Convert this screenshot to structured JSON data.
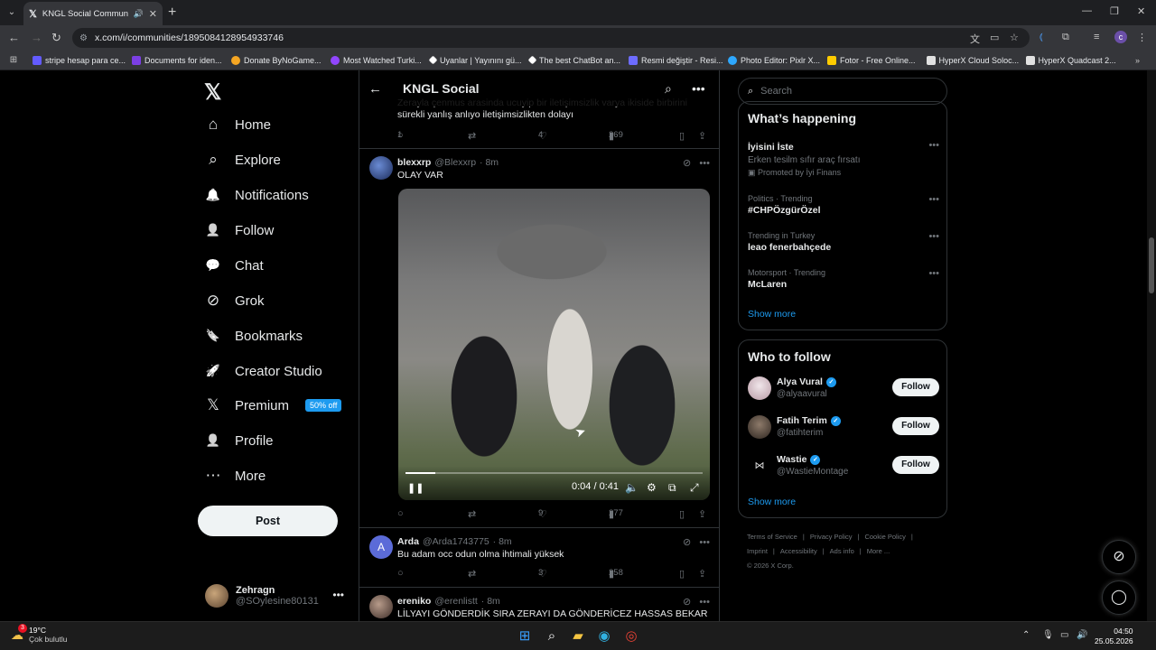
{
  "browser": {
    "tab_title": "KNGL Social Community / X",
    "url": "x.com/i/communities/1895084128954933746",
    "bookmarks": [
      {
        "label": "stripe hesap para ce...",
        "color": "#635bff"
      },
      {
        "label": "Documents for iden...",
        "color": "#7b3fe4"
      },
      {
        "label": "Donate ByNoGame...",
        "color": "#f5a623"
      },
      {
        "label": "Most Watched Turki...",
        "color": "#9146ff"
      },
      {
        "label": "Uyanlar | Yayınını gü...",
        "color": "#ffffff"
      },
      {
        "label": "The best ChatBot an...",
        "color": "#ffffff"
      },
      {
        "label": "Resmi değiştir - Resi...",
        "color": "#6d6cff"
      },
      {
        "label": "Photo Editor: Pixlr X...",
        "color": "#2ea8ff"
      },
      {
        "label": "Fotor - Free Online...",
        "color": "#ffcc00"
      },
      {
        "label": "HyperX Cloud Soloc...",
        "color": "#e1e1e1"
      },
      {
        "label": "HyperX Quadcast 2...",
        "color": "#e1e1e1"
      }
    ]
  },
  "nav": {
    "items": [
      {
        "label": "Home",
        "icon": "⌂"
      },
      {
        "label": "Explore",
        "icon": "⌕"
      },
      {
        "label": "Notifications",
        "icon": "🔔"
      },
      {
        "label": "Follow",
        "icon": "👤"
      },
      {
        "label": "Chat",
        "icon": "💬"
      },
      {
        "label": "Grok",
        "icon": "⊘"
      },
      {
        "label": "Bookmarks",
        "icon": "🔖"
      },
      {
        "label": "Creator Studio",
        "icon": "🚀"
      },
      {
        "label": "Premium",
        "icon": "𝕏"
      },
      {
        "label": "Profile",
        "icon": "👤"
      },
      {
        "label": "More",
        "icon": "⋯"
      }
    ],
    "premium_badge": "50% off",
    "post_label": "Post",
    "account": {
      "name": "Zehragn",
      "handle": "@SOylesine80131"
    }
  },
  "center": {
    "title": "KNGL Social",
    "partial_post": {
      "line1": "Zerayla çenmus arasinda ucuyip bir iletişimsizlik varya ikiside birbirini",
      "line2": "sürekli yanlış anlıyo iletişimsizlikten dolayı",
      "replies": "1",
      "likes": "4",
      "views": "269"
    },
    "posts": [
      {
        "name": "blexxrp",
        "handle": "@Blexxrp",
        "time": "· 8m",
        "text": "OLAY VAR",
        "video": {
          "time": "0:04 / 0:41",
          "progress": 0.1
        },
        "replies": "",
        "likes": "9",
        "views": "277"
      },
      {
        "name": "Arda",
        "handle": "@Arda1743775",
        "time": "· 8m",
        "text": "Bu adam occ odun olma ihtimali yüksek",
        "replies": "",
        "likes": "3",
        "views": "258"
      },
      {
        "name": "ereniko",
        "handle": "@erenlistt",
        "time": "· 8m",
        "text": "LİLYAYI GÖNDERDİK SIRA ZERAYI DA GÖNDERİCEZ HASSAS BEKAR"
      }
    ]
  },
  "right": {
    "search_placeholder": "Search",
    "happening_title": "What’s happening",
    "trends": [
      {
        "meta": "",
        "name": "İyisini İste",
        "sub": "Erken tesilm sıfır araç fırsatı",
        "promo": "Promoted by İyi Finans"
      },
      {
        "meta": "Politics · Trending",
        "name": "#CHPÖzgürÖzel",
        "sub": "",
        "promo": ""
      },
      {
        "meta": "Trending in Turkey",
        "name": "leao fenerbahçede",
        "sub": "",
        "promo": ""
      },
      {
        "meta": "Motorsport · Trending",
        "name": "McLaren",
        "sub": "",
        "promo": ""
      }
    ],
    "show_more": "Show more",
    "wtf_title": "Who to follow",
    "wtf": [
      {
        "name": "Alya Vural",
        "handle": "@alyaavural"
      },
      {
        "name": "Fatih Terim",
        "handle": "@fatihterim"
      },
      {
        "name": "Wastie",
        "handle": "@WastieMontage"
      }
    ],
    "follow_label": "Follow",
    "footer": [
      "Terms of Service",
      "|",
      "Privacy Policy",
      "|",
      "Cookie Policy",
      "|",
      "Imprint",
      "|",
      "Accessibility",
      "|",
      "Ads info",
      "|",
      "More ...",
      "© 2026 X Corp."
    ]
  },
  "taskbar": {
    "temp": "19°C",
    "weather": "Çok bulutlu",
    "time": "04:50",
    "date": "25.05.2026",
    "notif_count": "3"
  }
}
